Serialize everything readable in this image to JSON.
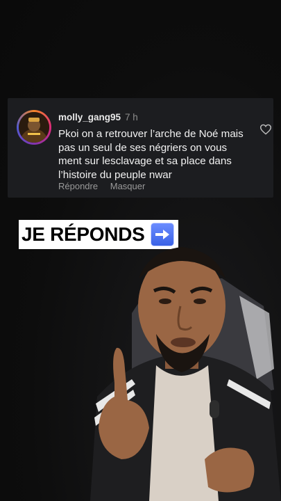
{
  "comment": {
    "username": "molly_gang95",
    "time": "7 h",
    "text": "Pkoi on a retrouver l’arche de Noé mais pas un seul de ses négriers on vous ment sur lesclavage et sa place dans l’histoire du peuple nwar",
    "reply_label": "Répondre",
    "hide_label": "Masquer",
    "avatar_icon": "avatar-icon",
    "like_icon": "heart-icon"
  },
  "overlay": {
    "caption": "JE RÉPONDS",
    "arrow_icon": "right-arrow-icon",
    "arrow_color": "#3a62e6"
  }
}
